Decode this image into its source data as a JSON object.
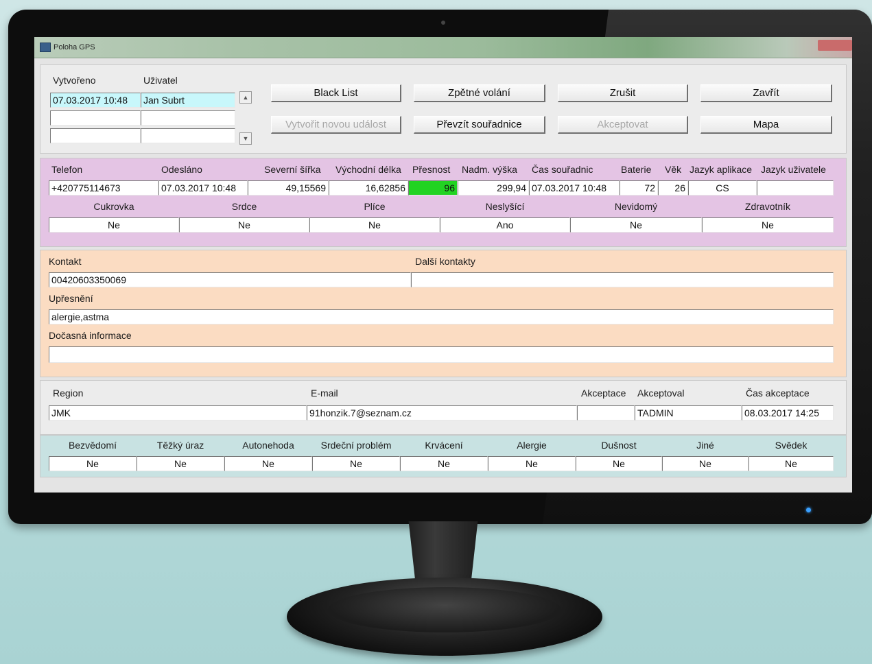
{
  "window": {
    "title": "Poloha GPS"
  },
  "header": {
    "created_label": "Vytvořeno",
    "user_label": "Uživatel",
    "rows": [
      {
        "created": "07.03.2017 10:48",
        "user": "Jan Subrt"
      },
      {
        "created": "",
        "user": ""
      },
      {
        "created": "",
        "user": ""
      }
    ]
  },
  "buttons": {
    "black_list": "Black List",
    "callback": "Zpětné volání",
    "cancel": "Zrušit",
    "close": "Zavřít",
    "create_event": "Vytvořit novou událost",
    "take_coords": "Převzít souřadnice",
    "accept": "Akceptovat",
    "map": "Mapa"
  },
  "gps": {
    "headers": {
      "phone": "Telefon",
      "sent": "Odesláno",
      "lat": "Severní šířka",
      "lon": "Východní délka",
      "accuracy": "Přesnost",
      "altitude": "Nadm. výška",
      "coord_time": "Čas souřadnic",
      "battery": "Baterie",
      "age": "Věk",
      "app_lang": "Jazyk aplikace",
      "user_lang": "Jazyk uživatele"
    },
    "values": {
      "phone": "+420775114673",
      "sent": "07.03.2017 10:48",
      "lat": "49,15569",
      "lon": "16,62856",
      "accuracy": "96",
      "altitude": "299,94",
      "coord_time": "07.03.2017 10:48",
      "battery": "72",
      "age": "26",
      "app_lang": "CS",
      "user_lang": ""
    }
  },
  "health": {
    "labels": [
      "Cukrovka",
      "Srdce",
      "Plíce",
      "Neslyšící",
      "Nevidomý",
      "Zdravotník"
    ],
    "values": [
      "Ne",
      "Ne",
      "Ne",
      "Ano",
      "Ne",
      "Ne"
    ]
  },
  "contact": {
    "contact_label": "Kontakt",
    "contact_value": "00420603350069",
    "other_label": "Další kontakty",
    "other_value": "",
    "note_label": "Upřesnění",
    "note_value": "alergie,astma",
    "temp_label": "Dočasná informace",
    "temp_value": ""
  },
  "meta": {
    "region_label": "Region",
    "region_value": "JMK",
    "email_label": "E-mail",
    "email_value": "91honzik.7@seznam.cz",
    "acceptance_label": "Akceptace",
    "acceptance_value": "",
    "accepted_by_label": "Akceptoval",
    "accepted_by_value": "TADMIN",
    "accept_time_label": "Čas akceptace",
    "accept_time_value": "08.03.2017 14:25"
  },
  "emergency": {
    "labels": [
      "Bezvědomí",
      "Těžký úraz",
      "Autonehoda",
      "Srdeční problém",
      "Krvácení",
      "Alergie",
      "Dušnost",
      "Jiné",
      "Svědek"
    ],
    "values": [
      "Ne",
      "Ne",
      "Ne",
      "Ne",
      "Ne",
      "Ne",
      "Ne",
      "Ne",
      "Ne"
    ]
  },
  "colors": {
    "accent_cyan": "#c8f7fb",
    "accuracy_green": "#22d322",
    "panel_purple": "#e4c4e4",
    "panel_orange": "#fbdcc2",
    "panel_teal": "#c8e2e2"
  }
}
